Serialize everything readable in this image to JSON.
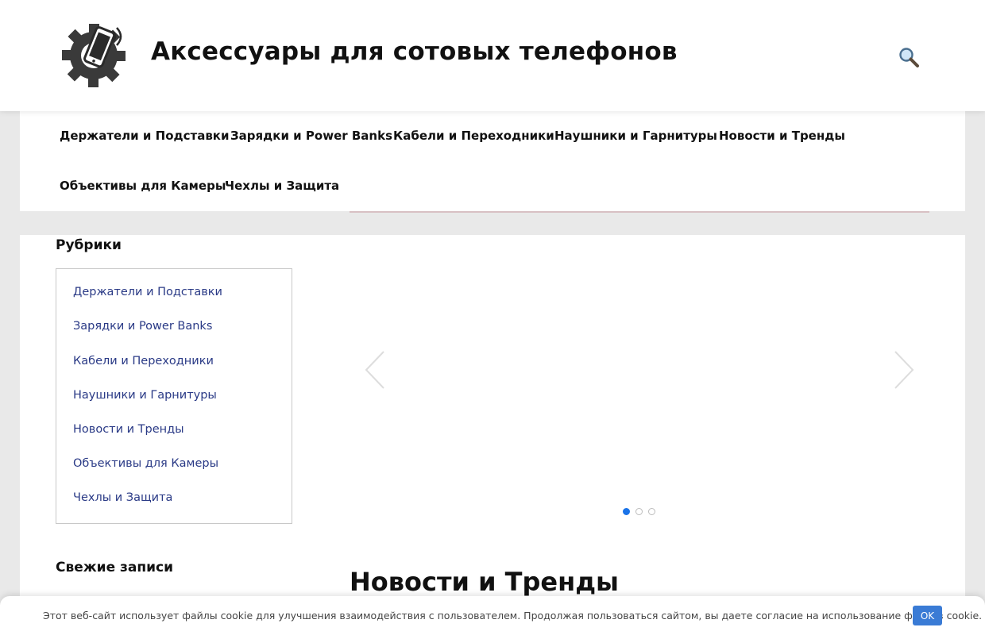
{
  "header": {
    "site_title": "Аксессуары для сотовых телефонов",
    "logo_icon": "gear-phone-logo-icon",
    "search_icon": "search-icon"
  },
  "nav": {
    "items": [
      {
        "label": "Держатели и Подставки"
      },
      {
        "label": "Зарядки и Power Banks"
      },
      {
        "label": "Кабели и Переходники"
      },
      {
        "label": "Наушники и Гарнитуры"
      },
      {
        "label": "Новости и Тренды"
      },
      {
        "label": "Объективы для Камеры"
      },
      {
        "label": "Чехлы и Защита"
      }
    ]
  },
  "sidebar": {
    "categories_title": "Рубрики",
    "categories": [
      {
        "label": "Держатели и Подставки"
      },
      {
        "label": "Зарядки и Power Banks"
      },
      {
        "label": "Кабели и Переходники"
      },
      {
        "label": "Наушники и Гарнитуры"
      },
      {
        "label": "Новости и Тренды"
      },
      {
        "label": "Объективы для Камеры"
      },
      {
        "label": "Чехлы и Защита"
      }
    ],
    "recent_title": "Свежие записи"
  },
  "slider": {
    "prev_icon": "chevron-left-icon",
    "next_icon": "chevron-right-icon",
    "slide_count": 3,
    "active_slide": 1
  },
  "main": {
    "section_heading": "Новости и Тренды"
  },
  "cookie": {
    "text": "Этот веб-сайт использует файлы cookie для улучшения взаимодействия с пользователем. Продолжая пользоваться сайтом, вы даете согласие на использование файлов cookie.",
    "ok_label": "OK"
  },
  "colors": {
    "link": "#2a3a86",
    "accent": "#1a73e8",
    "ok_button": "#3a7bd5"
  }
}
